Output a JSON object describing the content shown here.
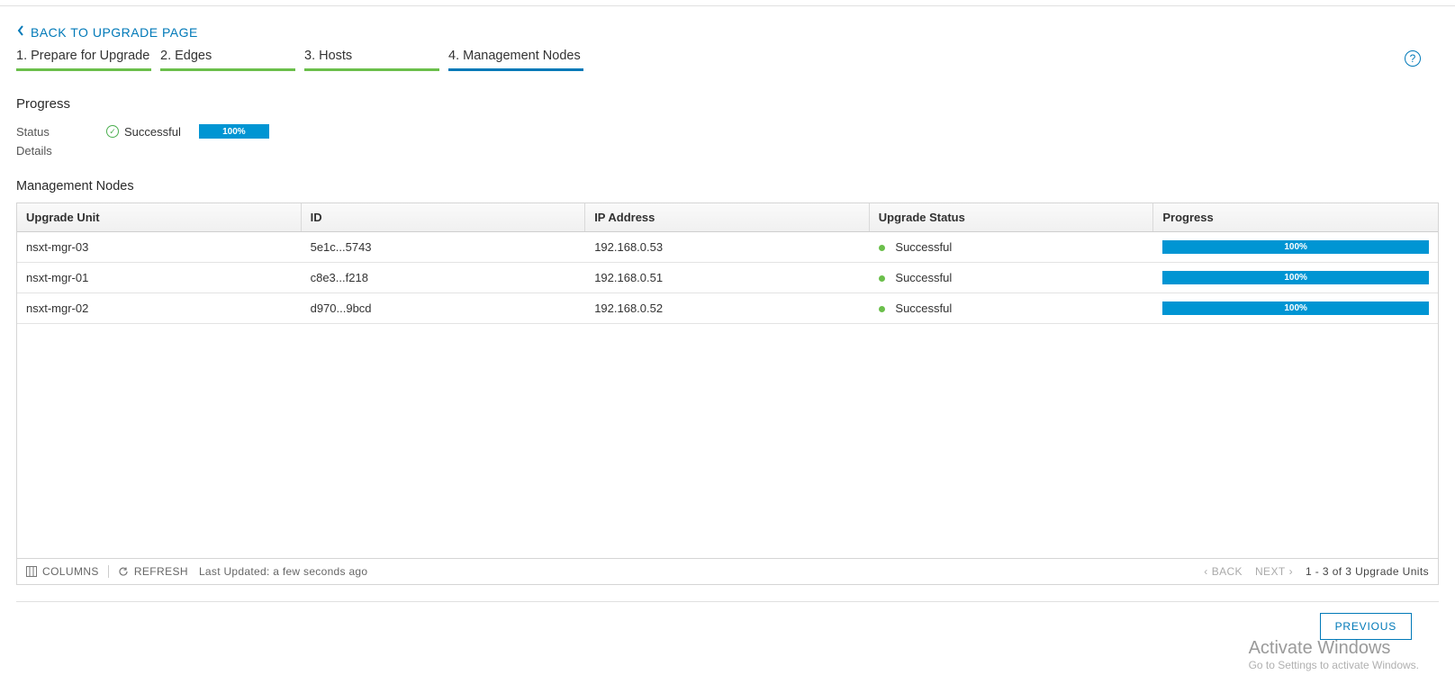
{
  "nav": {
    "back_label": "BACK TO UPGRADE PAGE"
  },
  "wizard": {
    "steps": [
      {
        "label": "1. Prepare for Upgrade",
        "state": "completed"
      },
      {
        "label": "2. Edges",
        "state": "completed"
      },
      {
        "label": "3. Hosts",
        "state": "completed"
      },
      {
        "label": "4. Management Nodes",
        "state": "current"
      }
    ]
  },
  "progress": {
    "section_title": "Progress",
    "status_label": "Status",
    "status_value": "Successful",
    "percent_text": "100%",
    "details_label": "Details"
  },
  "table": {
    "title": "Management Nodes",
    "columns": {
      "unit": "Upgrade Unit",
      "id": "ID",
      "ip": "IP Address",
      "status": "Upgrade Status",
      "progress": "Progress"
    },
    "rows": [
      {
        "unit": "nsxt-mgr-03",
        "id": "5e1c...5743",
        "ip": "192.168.0.53",
        "status": "Successful",
        "progress": "100%"
      },
      {
        "unit": "nsxt-mgr-01",
        "id": "c8e3...f218",
        "ip": "192.168.0.51",
        "status": "Successful",
        "progress": "100%"
      },
      {
        "unit": "nsxt-mgr-02",
        "id": "d970...9bcd",
        "ip": "192.168.0.52",
        "status": "Successful",
        "progress": "100%"
      }
    ],
    "footer": {
      "columns_label": "COLUMNS",
      "refresh_label": "REFRESH",
      "last_updated": "Last Updated: a few seconds ago",
      "back_label": "BACK",
      "next_label": "NEXT",
      "range_text": "1 - 3 of 3 Upgrade Units"
    }
  },
  "actions": {
    "previous": "PREVIOUS"
  },
  "watermark": {
    "line1": "Activate Windows",
    "line2": "Go to Settings to activate Windows."
  }
}
